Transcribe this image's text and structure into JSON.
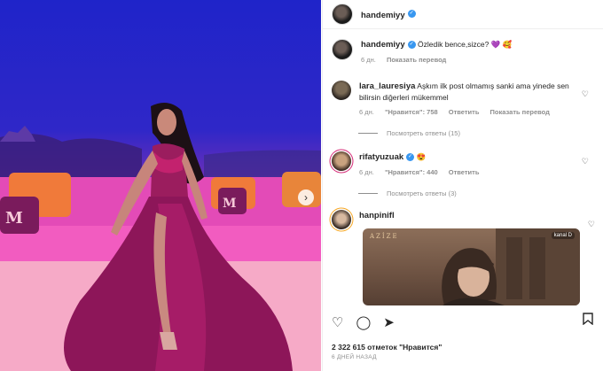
{
  "post": {
    "author": "handemiyy",
    "verified_mark": "✓",
    "likes_text": "2 322 615 отметок \"Нравится\"",
    "date_text": "6 ДНЕЙ НАЗАД"
  },
  "caption": {
    "user": "handemiyy",
    "text": "Özledik bence,sizce? 💜 🥰",
    "time": "6 дн.",
    "action": "Показать перевод"
  },
  "comments": [
    {
      "user": "lara_lauresiya",
      "text": "Aşkım ilk post olmamış sanki ama yinede sen bilirsin diğerleri mükemmel",
      "time": "6 дн.",
      "likes": "\"Нравится\": 758",
      "reply": "Ответить",
      "translate": "Показать перевод",
      "replies": "Посмотреть ответы (15)"
    },
    {
      "user": "rifatyuzuak",
      "text": "😍",
      "time": "6 дн.",
      "likes": "\"Нравится\": 440",
      "reply": "Ответить",
      "replies": "Посмотреть ответы (3)"
    },
    {
      "user": "hanpinifl",
      "gif_title": "AZİZE",
      "gif_logo": "kanal D"
    }
  ],
  "icons": {
    "heart": "heart-icon",
    "comment": "comment-icon",
    "share": "share-icon",
    "bookmark": "bookmark-icon",
    "next": "chevron-right-icon"
  },
  "colors": {
    "verified": "#3897f0",
    "meta": "#8e8e8e"
  }
}
